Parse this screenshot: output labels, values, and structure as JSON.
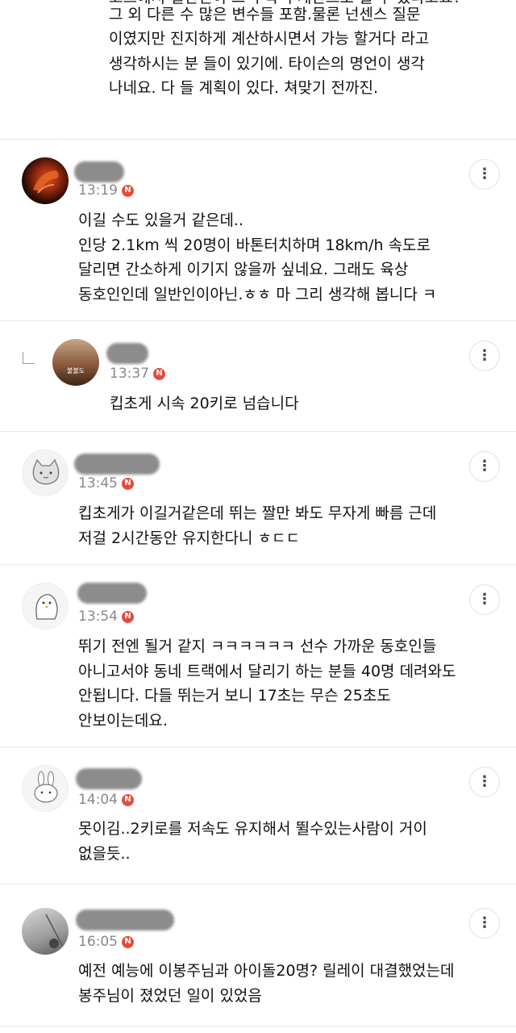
{
  "top_text": {
    "lines": [
      "코스에서 일반인이 그 수학적 계산으로 될 수 있다고요?",
      "그 외 다른 수 많은 변수들 포함.물론 넌센스 질문",
      "이였지만 진지하게 계산하시면서 가능 할거다 라고",
      "생각하시는 분 들이 있기에. 타이슨의 명언이 생각",
      "나네요. 다 들 계획이 있다. 쳐맞기 전까진."
    ]
  },
  "badge_letter": "N",
  "menu_glyph": "⋮",
  "comments": [
    {
      "time": "13:19",
      "lines": [
        "이길 수도 있을거 같은데..",
        "인당 2.1km 씩 20명이 바톤터치하며 18km/h 속도로",
        "달리면 간소하게 이기지 않을까 싶네요. 그래도 육상",
        "동호인인데 일반인이아닌.ㅎㅎ 마 그리 생각해 봅니다 ㅋ"
      ]
    },
    {
      "time": "13:37",
      "lines": [
        "킵초게 시속 20키로 넘습니다"
      ],
      "avatar_text": "불불도"
    },
    {
      "time": "13:45",
      "lines": [
        "킵초게가 이길거같은데 뛰는 짤만 봐도 무자게 빠름 근데",
        "저걸 2시간동안 유지한다니 ㅎㄷㄷ"
      ]
    },
    {
      "time": "13:54",
      "lines": [
        "뛰기 전엔 될거 같지 ㅋㅋㅋㅋㅋㅋ 선수 가까운 동호인들",
        "아니고서야 동네 트랙에서 달리기 하는 분들 40명 데려와도",
        "안됩니다. 다들 뛰는거 보니 17초는 무슨 25초도",
        "안보이는데요."
      ]
    },
    {
      "time": "14:04",
      "lines": [
        "못이김..2키로를 저속도 유지해서 뛸수있는사람이 거이",
        "없을듯.."
      ]
    },
    {
      "time": "16:05",
      "lines": [
        "예전 예능에 이봉주님과 아이돌20명? 릴레이 대결했었는데",
        "봉주님이 졌었던 일이 있었음"
      ]
    }
  ]
}
